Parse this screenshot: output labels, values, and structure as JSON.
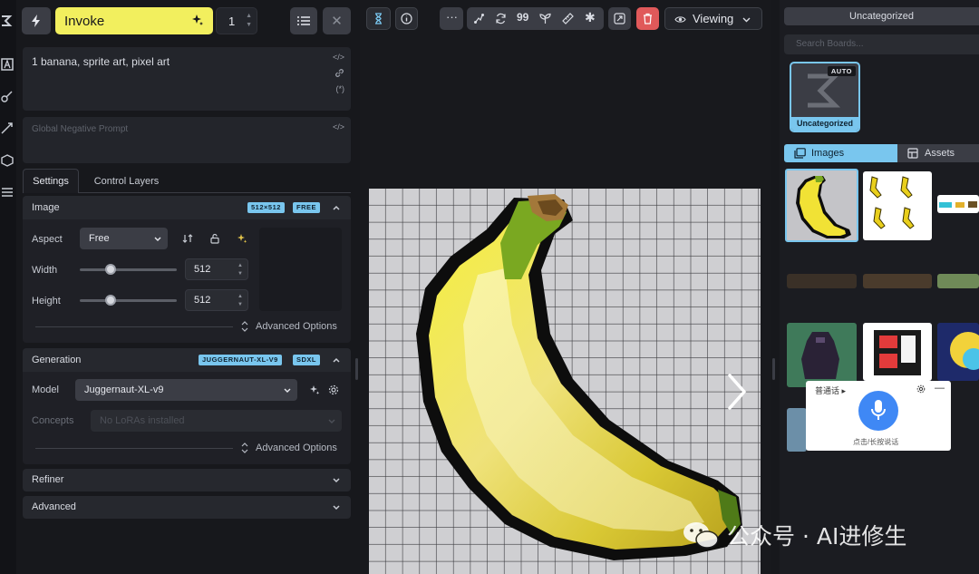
{
  "toolbar": {
    "invoke_label": "Invoke",
    "iterations": "1"
  },
  "prompt": {
    "positive": "1 banana, sprite art, pixel art",
    "negative_placeholder": "Global Negative Prompt"
  },
  "tabs": [
    "Settings",
    "Control Layers"
  ],
  "image_panel": {
    "title": "Image",
    "badges": [
      "512×512",
      "FREE"
    ],
    "aspect_label": "Aspect",
    "aspect_value": "Free",
    "width_label": "Width",
    "width_value": "512",
    "width_fraction": 0.32,
    "height_label": "Height",
    "height_value": "512",
    "height_fraction": 0.32,
    "advanced_label": "Advanced Options"
  },
  "generation_panel": {
    "title": "Generation",
    "badges": [
      "JUGGERNAUT-XL-V9",
      "SDXL"
    ],
    "model_label": "Model",
    "model_value": "Juggernaut-XL-v9",
    "concepts_label": "Concepts",
    "concepts_placeholder": "No LoRAs installed",
    "advanced_label": "Advanced Options"
  },
  "refiner_title": "Refiner",
  "advanced_title": "Advanced",
  "viewer": {
    "mode_label": "Viewing"
  },
  "gallery": {
    "board_select": "Uncategorized",
    "search_placeholder": "Search Boards...",
    "board_tile_badge": "AUTO",
    "board_tile_name": "Uncategorized",
    "tab_images": "Images",
    "tab_assets": "Assets"
  },
  "voice_popup": {
    "mode": "普通话",
    "hint": "点击/长按说话"
  },
  "watermark": "公众号 · AI进修生",
  "colors": {
    "accent_yellow": "#f2ef5e",
    "accent_blue": "#79c6ee",
    "danger_red": "#e0595a",
    "panel_bg": "#1f2026"
  }
}
